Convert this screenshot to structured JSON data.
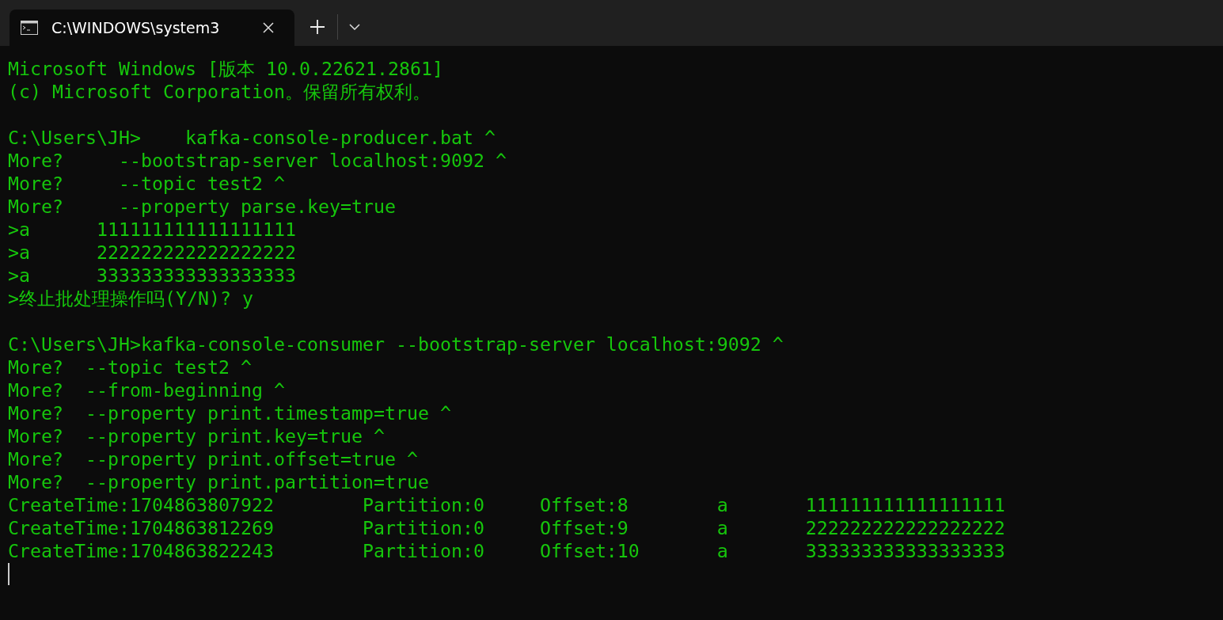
{
  "tabs": [
    {
      "title": "C:\\WINDOWS\\system3",
      "selected": true
    }
  ],
  "terminal": {
    "blocks": [
      [
        "Microsoft Windows [版本 10.0.22621.2861]",
        "(c) Microsoft Corporation。保留所有权利。"
      ],
      [
        "C:\\Users\\JH>    kafka-console-producer.bat ^",
        "More?     --bootstrap-server localhost:9092 ^",
        "More?     --topic test2 ^",
        "More?     --property parse.key=true",
        ">a      111111111111111111",
        ">a      222222222222222222",
        ">a      333333333333333333",
        ">终止批处理操作吗(Y/N)? y"
      ],
      [
        "C:\\Users\\JH>kafka-console-consumer --bootstrap-server localhost:9092 ^",
        "More?  --topic test2 ^",
        "More?  --from-beginning ^",
        "More?  --property print.timestamp=true ^",
        "More?  --property print.key=true ^",
        "More?  --property print.offset=true ^",
        "More?  --property print.partition=true",
        "CreateTime:1704863807922        Partition:0     Offset:8        a       111111111111111111",
        "CreateTime:1704863812269        Partition:0     Offset:9        a       222222222222222222",
        "CreateTime:1704863822243        Partition:0     Offset:10       a       333333333333333333"
      ]
    ],
    "cursor_visible": true
  }
}
